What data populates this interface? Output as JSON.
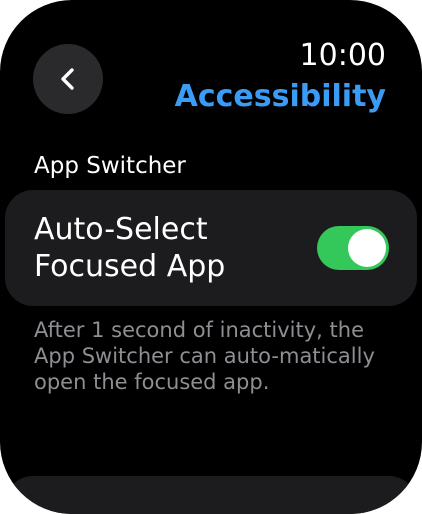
{
  "status": {
    "time": "10:00"
  },
  "nav": {
    "title": "Accessibility",
    "back_icon": "chevron-left-icon",
    "accent_color": "#3b9cf6"
  },
  "section": {
    "header": "App Switcher"
  },
  "setting": {
    "label_line1": "Auto-Select",
    "label_line2": "Focused App",
    "enabled": true,
    "toggle_on_color": "#34c759",
    "footnote": "After 1 second of inactivity, the App Switcher can auto-matically open the focused app."
  }
}
